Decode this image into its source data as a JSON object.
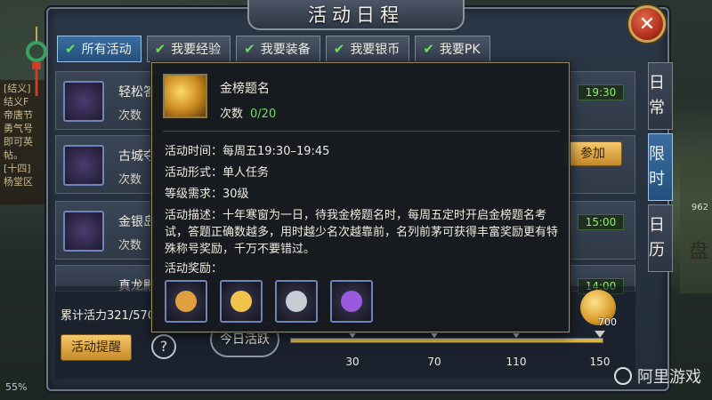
{
  "window": {
    "title": "活动日程",
    "close_icon": "close-icon"
  },
  "background": {
    "chat_lines": [
      "[结义]",
      "结义F",
      "帝唐节",
      "勇气号",
      "即可英",
      "帖。",
      "[十四]",
      "杨堂区"
    ],
    "side_number": "962",
    "side_char": "盘",
    "bottom_percent": "55%"
  },
  "tabs": [
    {
      "label": "所有活动",
      "active": true
    },
    {
      "label": "我要经验",
      "active": false
    },
    {
      "label": "我要装备",
      "active": false
    },
    {
      "label": "我要银币",
      "active": false
    },
    {
      "label": "我要PK",
      "active": false
    }
  ],
  "side_tabs": [
    {
      "label": "日常",
      "active": false
    },
    {
      "label": "限时",
      "active": true
    },
    {
      "label": "日历",
      "active": false
    }
  ],
  "rows": [
    {
      "name": "轻松答",
      "count_label": "次数",
      "time": "19:30",
      "icon_color": "#8a5ad0"
    },
    {
      "name": "古城夺",
      "count_label": "次数",
      "button": "参加",
      "icon_color": "#3a9a5a"
    },
    {
      "name": "金银岛",
      "count_label": "次数",
      "time": "15:00",
      "icon_color": "#3a7ad0"
    },
    {
      "name": "真龙殿",
      "count_label": "",
      "time": "14:00",
      "icon_color": "#7a6a3a"
    }
  ],
  "bottom": {
    "vitality": "累计活力321/570",
    "remind_button": "活动提醒",
    "help_icon": "?",
    "today_button": "今日活跃",
    "progress": 1.0,
    "milestones": [
      "30",
      "70",
      "110",
      "150"
    ],
    "reward_count": "700"
  },
  "tooltip": {
    "title": "金榜题名",
    "count_label": "次数",
    "count_value": "0/20",
    "time_line": "活动时间：每周五19:30–19:45",
    "form_line": "活动形式：单人任务",
    "level_line": "等级需求：30级",
    "desc": "活动描述：十年寒窗为一日，待我金榜题名时，每周五定时开启金榜题名考试，答题正确数越多，用时越少名次越靠前，名列前茅可获得丰富奖励更有特殊称号奖励，千万不要错过。",
    "reward_label": "活动奖励：",
    "rewards": [
      {
        "name": "scroll-reward-icon",
        "color": "#e0a040"
      },
      {
        "name": "gold-coin-reward-icon",
        "color": "#f2c34a"
      },
      {
        "name": "silver-coin-reward-icon",
        "color": "#c8ccd4"
      },
      {
        "name": "book-reward-icon",
        "color": "#9a5ae0"
      }
    ]
  },
  "watermark": "阿里游戏"
}
